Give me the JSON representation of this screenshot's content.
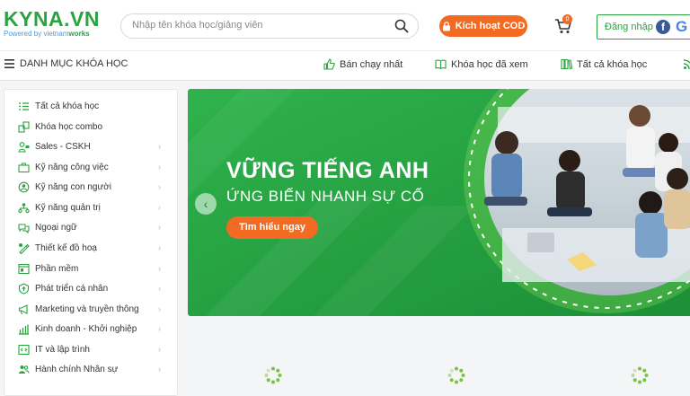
{
  "header": {
    "logo_main": "KYNA.VN",
    "logo_sub_prefix": "Powered by vietnam",
    "logo_sub_suffix": "works",
    "search_placeholder": "Nhập tên khóa học/giảng viên",
    "cod_label": "Kích hoạt COD",
    "cart_count": "0",
    "login_label": "Đăng nhập",
    "fb_letter": "f",
    "google_letter": "G"
  },
  "navbar": {
    "menu_label": "DANH MỤC KHÓA HỌC",
    "links": [
      "Bán chạy nhất",
      "Khóa học đã xem",
      "Tất cả khóa học"
    ]
  },
  "sidebar": {
    "items": [
      {
        "label": "Tất cả khóa học",
        "icon": "list-icon",
        "arrow": false
      },
      {
        "label": "Khóa học combo",
        "icon": "combo-icon",
        "arrow": false
      },
      {
        "label": "Sales - CSKH",
        "icon": "sales-icon",
        "arrow": true
      },
      {
        "label": "Kỹ năng công việc",
        "icon": "briefcase-icon",
        "arrow": true
      },
      {
        "label": "Kỹ năng con người",
        "icon": "people-icon",
        "arrow": true
      },
      {
        "label": "Kỹ năng quản trị",
        "icon": "management-icon",
        "arrow": true
      },
      {
        "label": "Ngoại ngữ",
        "icon": "language-icon",
        "arrow": true
      },
      {
        "label": "Thiết kế đồ hoạ",
        "icon": "design-icon",
        "arrow": true
      },
      {
        "label": "Phần mềm",
        "icon": "software-icon",
        "arrow": true
      },
      {
        "label": "Phát triển cá nhân",
        "icon": "growth-icon",
        "arrow": true
      },
      {
        "label": "Marketing và truyền thông",
        "icon": "marketing-icon",
        "arrow": true
      },
      {
        "label": "Kinh doanh - Khởi nghiệp",
        "icon": "business-icon",
        "arrow": true
      },
      {
        "label": "IT và lập trình",
        "icon": "code-icon",
        "arrow": true
      },
      {
        "label": "Hành chính Nhân sự",
        "icon": "hr-icon",
        "arrow": true
      }
    ],
    "arrow_glyph": "›"
  },
  "banner": {
    "title": "VỮNG TIẾNG ANH",
    "subtitle": "ỨNG BIẾN NHANH SỰ CỐ",
    "cta": "Tìm hiểu ngay",
    "prev_glyph": "‹"
  },
  "colors": {
    "brand_green": "#2aa341",
    "accent_orange": "#f36a22"
  }
}
